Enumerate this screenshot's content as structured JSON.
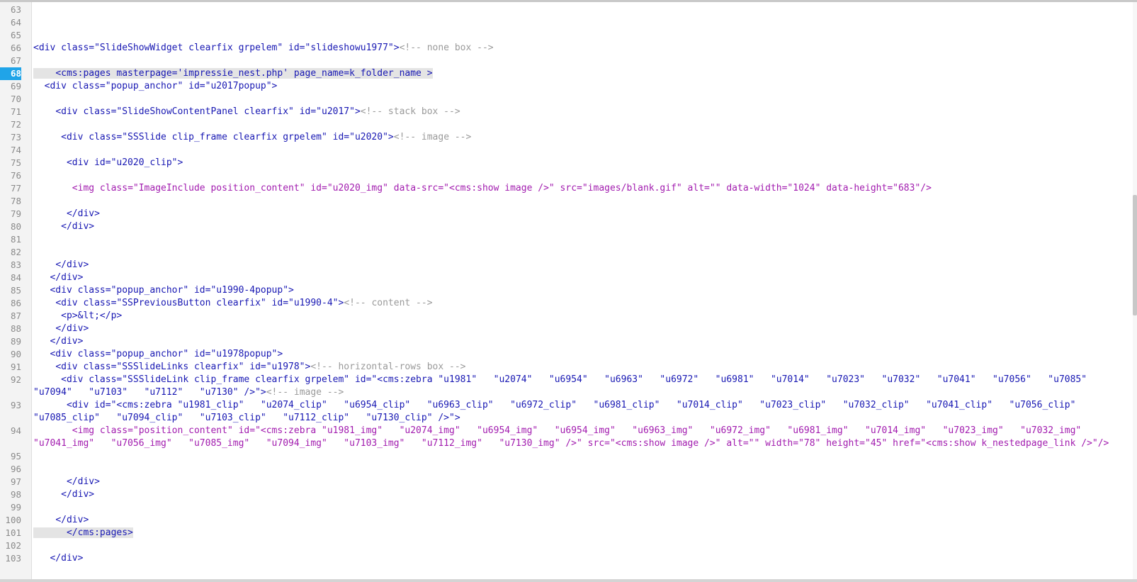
{
  "editor": {
    "lines": [
      {
        "num": "63",
        "text": ""
      },
      {
        "num": "64",
        "text": ""
      },
      {
        "num": "65",
        "text": ""
      },
      {
        "num": "66",
        "text": "<div class=\"SlideShowWidget clearfix grpelem\" id=\"slideshowu1977\">",
        "comment": "<!-- none box -->"
      },
      {
        "num": "67",
        "text": ""
      },
      {
        "num": "68",
        "text": "    <cms:pages masterpage='impressie_nest.php' page_name=k_folder_name >",
        "active": true
      },
      {
        "num": "69",
        "text": "  <div class=\"popup_anchor\" id=\"u2017popup\">"
      },
      {
        "num": "70",
        "text": ""
      },
      {
        "num": "71",
        "text": "    <div class=\"SlideShowContentPanel clearfix\" id=\"u2017\">",
        "comment": "<!-- stack box -->"
      },
      {
        "num": "72",
        "text": ""
      },
      {
        "num": "73",
        "text": "     <div class=\"SSSlide clip_frame clearfix grpelem\" id=\"u2020\">",
        "comment": "<!-- image -->"
      },
      {
        "num": "74",
        "text": ""
      },
      {
        "num": "75",
        "text": "      <div id=\"u2020_clip\">"
      },
      {
        "num": "76",
        "text": ""
      },
      {
        "num": "77",
        "text": "       <img class=\"ImageInclude position_content\" id=\"u2020_img\" data-src=\"<cms:show image />\" src=\"images/blank.gif\" alt=\"\" data-width=\"1024\" data-height=\"683\"/>",
        "magenta": true
      },
      {
        "num": "78",
        "text": ""
      },
      {
        "num": "79",
        "text": "      </div>"
      },
      {
        "num": "80",
        "text": "     </div>"
      },
      {
        "num": "81",
        "text": ""
      },
      {
        "num": "82",
        "text": ""
      },
      {
        "num": "83",
        "text": "    </div>"
      },
      {
        "num": "84",
        "text": "   </div>"
      },
      {
        "num": "85",
        "text": "   <div class=\"popup_anchor\" id=\"u1990-4popup\">"
      },
      {
        "num": "86",
        "text": "    <div class=\"SSPreviousButton clearfix\" id=\"u1990-4\">",
        "comment": "<!-- content -->"
      },
      {
        "num": "87",
        "text": "     <p>&lt;</p>"
      },
      {
        "num": "88",
        "text": "    </div>"
      },
      {
        "num": "89",
        "text": "   </div>"
      },
      {
        "num": "90",
        "text": "   <div class=\"popup_anchor\" id=\"u1978popup\">"
      },
      {
        "num": "91",
        "text": "    <div class=\"SSSlideLinks clearfix\" id=\"u1978\">",
        "comment": "<!-- horizontal-rows box -->"
      },
      {
        "num": "92",
        "text": "     <div class=\"SSSlideLink clip_frame clearfix grpelem\" id=\"<cms:zebra \"u1981\"   \"u2074\"   \"u6954\"   \"u6963\"   \"u6972\"   \"u6981\"   \"u7014\"   \"u7023\"   \"u7032\"   \"u7041\"   \"u7056\"   \"u7085\"   \"u7094\"   \"u7103\"   \"u7112\"   \"u7130\" />\">",
        "comment": "<!-- image -->"
      },
      {
        "num": "93",
        "text": "      <div id=\"<cms:zebra \"u1981_clip\"   \"u2074_clip\"   \"u6954_clip\"   \"u6963_clip\"   \"u6972_clip\"   \"u6981_clip\"   \"u7014_clip\"   \"u7023_clip\"   \"u7032_clip\"   \"u7041_clip\"   \"u7056_clip\"   \"u7085_clip\"   \"u7094_clip\"   \"u7103_clip\"   \"u7112_clip\"   \"u7130_clip\" />\">"
      },
      {
        "num": "94",
        "text": "       <img class=\"position_content\" id=\"<cms:zebra \"u1981_img\"   \"u2074_img\"   \"u6954_img\"   \"u6954_img\"   \"u6963_img\"   \"u6972_img\"   \"u6981_img\"   \"u7014_img\"   \"u7023_img\"   \"u7032_img\"   \"u7041_img\"   \"u7056_img\"   \"u7085_img\"   \"u7094_img\"   \"u7103_img\"   \"u7112_img\"   \"u7130_img\" />\" src=\"<cms:show image />\" alt=\"\" width=\"78\" height=\"45\" href=\"<cms:show k_nestedpage_link />\"/>",
        "magenta": true
      },
      {
        "num": "95",
        "text": ""
      },
      {
        "num": "96",
        "text": ""
      },
      {
        "num": "97",
        "text": "      </div>"
      },
      {
        "num": "98",
        "text": "     </div>"
      },
      {
        "num": "99",
        "text": ""
      },
      {
        "num": "100",
        "text": "    </div>"
      },
      {
        "num": "101",
        "text": "      </cms:pages>",
        "highlight": true
      },
      {
        "num": "102",
        "text": ""
      },
      {
        "num": "103",
        "text": "   </div>"
      }
    ]
  }
}
